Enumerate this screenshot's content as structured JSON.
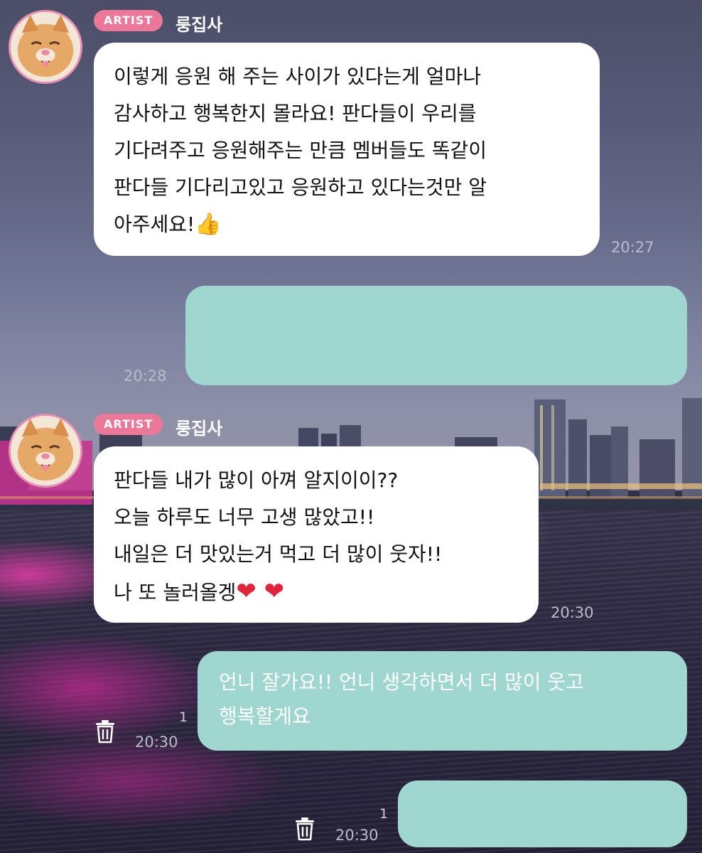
{
  "messages": [
    {
      "badge": "ARTIST",
      "sender": "룽집사",
      "text": "이렇게 응원 해 주는 사이가 있다는게 얼마나\n감사하고 행복한지 몰라요! 판다들이 우리를\n기다려주고 응원해주는 만큼 멤버들도 똑같이\n판다들 기다리고있고 응원하고 있다는것만 알\n아주세요!",
      "emoji": "👍",
      "time": "20:27"
    },
    {
      "text": "",
      "time": "20:28"
    },
    {
      "badge": "ARTIST",
      "sender": "룽집사",
      "text": "판다들 내가 많이 아껴 알지이이??\n오늘 하루도 너무 고생 많았고!!\n내일은 더 맛있는거 먹고 더 많이 웃자!!\n나 또 놀러올겡",
      "emoji": "❤ ❤",
      "time": "20:30"
    },
    {
      "text": "언니 잘가요!! 언니 생각하면서 더 많이 웃고\n행복할게요",
      "unread": "1",
      "time": "20:30",
      "icon": "trash-icon"
    },
    {
      "text": "",
      "unread": "1",
      "time": "20:30",
      "icon": "trash-icon"
    }
  ],
  "colors": {
    "artist_badge": "#ec7899",
    "outgoing_bubble": "#9fd6cf",
    "incoming_bubble": "#ffffff",
    "avatar_ring": "#e58fb3"
  }
}
